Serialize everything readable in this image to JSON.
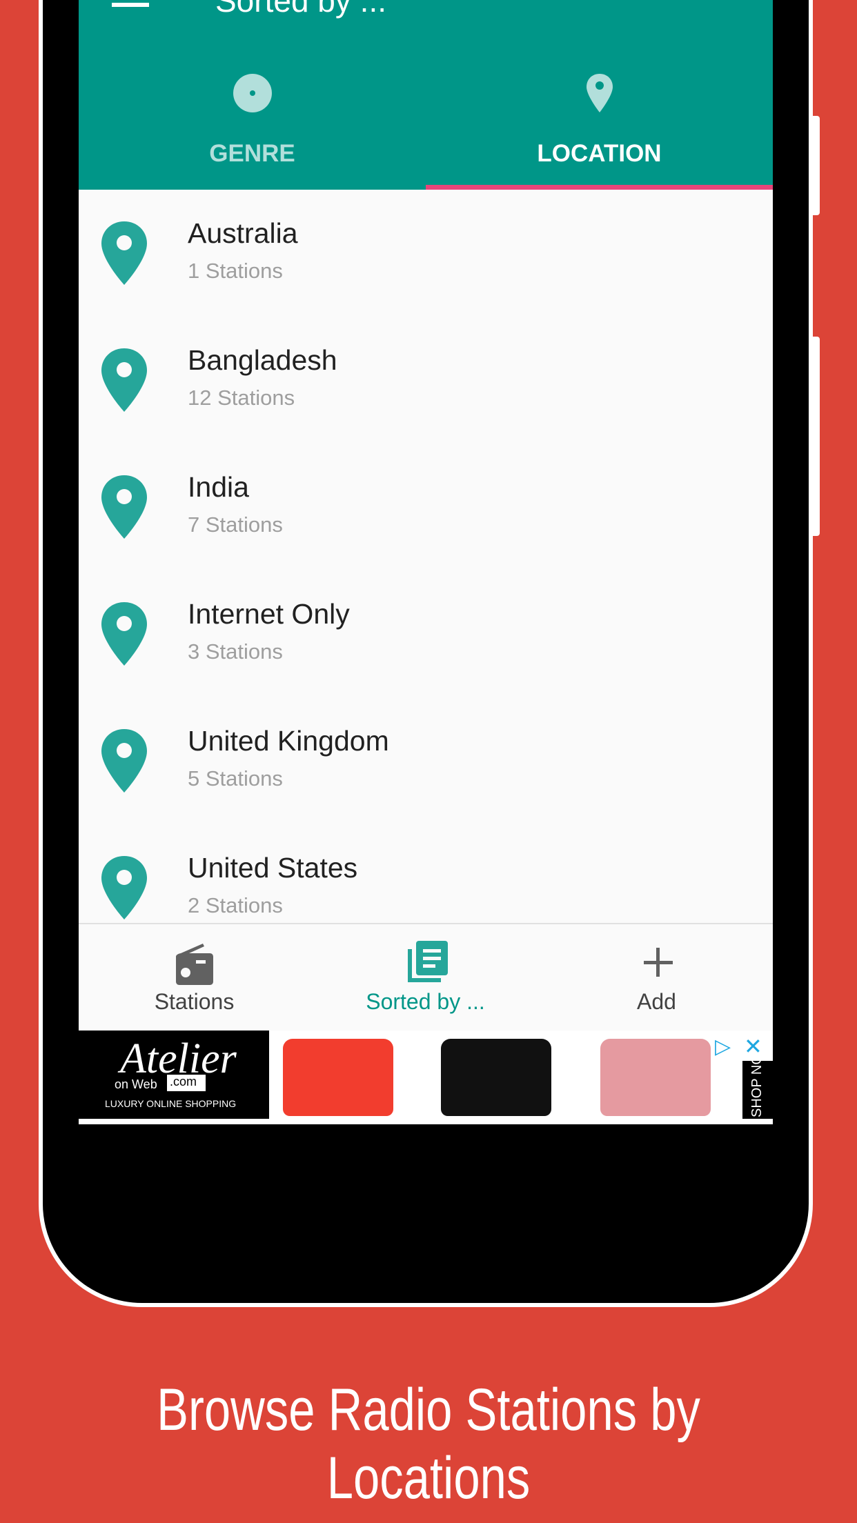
{
  "app_bar": {
    "title": "Sorted by ...",
    "menu_icon": "hamburger-menu-icon"
  },
  "tabs": [
    {
      "label": "GENRE",
      "icon": "disc-icon",
      "selected": false
    },
    {
      "label": "LOCATION",
      "icon": "map-pin-icon",
      "selected": true
    }
  ],
  "locations": [
    {
      "name": "Australia",
      "count": "1 Stations"
    },
    {
      "name": "Bangladesh",
      "count": "12 Stations"
    },
    {
      "name": "India",
      "count": "7 Stations"
    },
    {
      "name": "Internet Only",
      "count": "3 Stations"
    },
    {
      "name": "United Kingdom",
      "count": "5 Stations"
    },
    {
      "name": "United States",
      "count": "2 Stations"
    }
  ],
  "bottom_nav": [
    {
      "label": "Stations",
      "icon": "radio-icon"
    },
    {
      "label": "Sorted by ...",
      "icon": "library-icon",
      "selected": true
    },
    {
      "label": "Add",
      "icon": "plus-icon"
    }
  ],
  "ad": {
    "brand": "Atelier",
    "brand_sub": "on Web",
    "domain": ".com",
    "tagline": "LUXURY ONLINE SHOPPING",
    "cta": "SHOP NOW"
  },
  "caption": "Browse Radio Stations by Locations",
  "colors": {
    "primary": "#009688",
    "accent": "#e8457a",
    "background": "#dc4437",
    "pin": "#26a69a"
  }
}
